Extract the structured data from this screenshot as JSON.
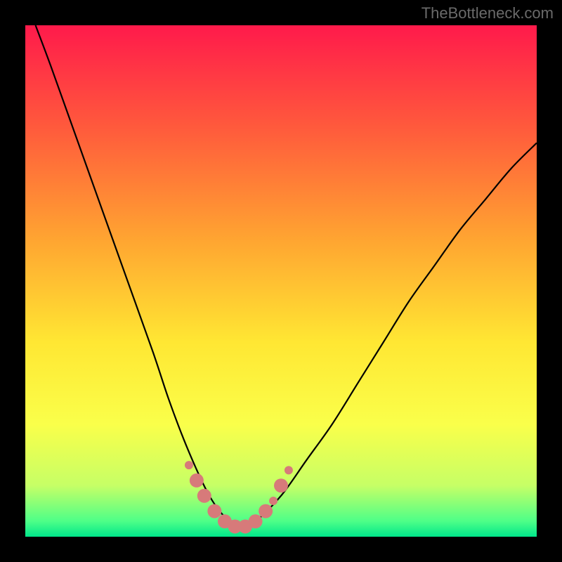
{
  "watermark": "TheBottleneck.com",
  "chart_data": {
    "type": "line",
    "title": "",
    "xlabel": "",
    "ylabel": "",
    "xlim": [
      0,
      100
    ],
    "ylim": [
      0,
      100
    ],
    "grid": false,
    "background": "rainbow-vertical-gradient",
    "gradient_stops": [
      {
        "pct": 0,
        "color": "#ff1a4b"
      },
      {
        "pct": 20,
        "color": "#ff5a3c"
      },
      {
        "pct": 42,
        "color": "#ffa531"
      },
      {
        "pct": 62,
        "color": "#ffe733"
      },
      {
        "pct": 78,
        "color": "#faff4a"
      },
      {
        "pct": 90,
        "color": "#c6ff66"
      },
      {
        "pct": 97,
        "color": "#4dff88"
      },
      {
        "pct": 100,
        "color": "#00e68a"
      }
    ],
    "series": [
      {
        "name": "bottleneck-curve",
        "color": "#000000",
        "x": [
          2,
          5,
          10,
          15,
          20,
          25,
          28,
          31,
          34,
          36,
          38,
          40,
          42,
          45,
          50,
          55,
          60,
          65,
          70,
          75,
          80,
          85,
          90,
          95,
          100
        ],
        "y": [
          100,
          92,
          78,
          64,
          50,
          36,
          27,
          19,
          12,
          8,
          5,
          3,
          2,
          3,
          8,
          15,
          22,
          30,
          38,
          46,
          53,
          60,
          66,
          72,
          77
        ]
      }
    ],
    "markers": {
      "name": "highlight-dots",
      "color": "#d77a7a",
      "radius_large": 10,
      "radius_small": 6,
      "points": [
        {
          "x": 32,
          "y": 14,
          "r": 6
        },
        {
          "x": 33.5,
          "y": 11,
          "r": 10
        },
        {
          "x": 35,
          "y": 8,
          "r": 10
        },
        {
          "x": 37,
          "y": 5,
          "r": 10
        },
        {
          "x": 39,
          "y": 3,
          "r": 10
        },
        {
          "x": 41,
          "y": 2,
          "r": 10
        },
        {
          "x": 43,
          "y": 2,
          "r": 10
        },
        {
          "x": 45,
          "y": 3,
          "r": 10
        },
        {
          "x": 47,
          "y": 5,
          "r": 10
        },
        {
          "x": 48.5,
          "y": 7,
          "r": 6
        },
        {
          "x": 50,
          "y": 10,
          "r": 10
        },
        {
          "x": 51.5,
          "y": 13,
          "r": 6
        }
      ]
    }
  }
}
